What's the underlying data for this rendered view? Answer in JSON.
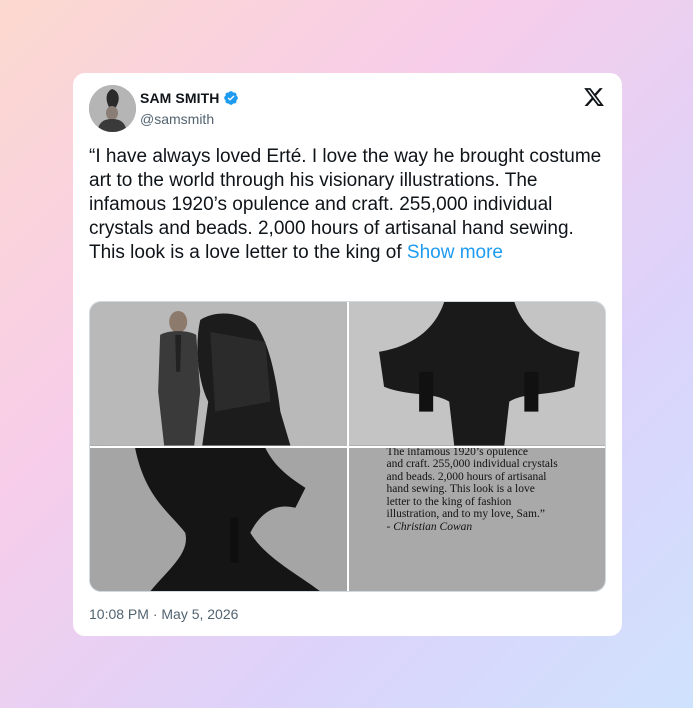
{
  "author": {
    "name": "SAM SMITH",
    "handle": "@samsmith",
    "verified": true
  },
  "icons": {
    "avatar": "profile-photo",
    "verified": "verified-badge-icon",
    "platform": "x-logo-icon"
  },
  "tweet": {
    "text": "“I have always loved Erté. I love the way he brought costume art to the world through his visionary illustrations. The infamous 1920’s opulence and craft. 255,000 individual crystals and beads. 2,000 hours of artisanal hand sewing. This look is a love letter to the king of",
    "show_more": "Show more",
    "timestamp": "10:08 PM · May 5, 2026"
  },
  "media": {
    "quote_lines": [
      "The infamous 1920’s opulence",
      "and craft. 255,000 individual crystals",
      "and beads. 2,000 hours of artisanal",
      "hand sewing. This look is a love",
      "letter to the king of fashion",
      "illustration, and to my love, Sam.”"
    ],
    "quote_signature": "- Christian Cowan"
  },
  "colors": {
    "link": "#1d9bf0",
    "verified": "#1d9bf0",
    "text": "#0f1419",
    "muted": "#536471"
  }
}
